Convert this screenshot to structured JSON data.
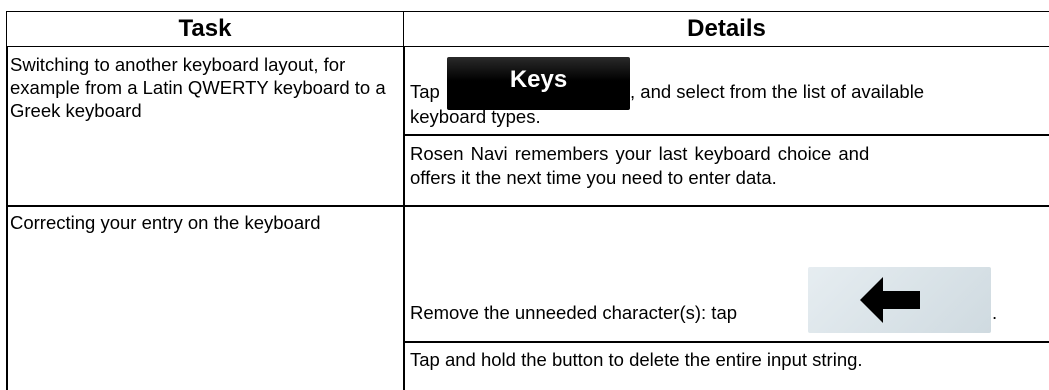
{
  "header": {
    "task": "Task",
    "details": "Details"
  },
  "rows": [
    {
      "task": "Switching to another keyboard layout, for example from a Latin QWERTY keyboard to a Greek keyboard",
      "details": [
        {
          "before_button": "Tap",
          "button_label": "Keys",
          "after_button": ", and select from the list of available",
          "line2": "keyboard types."
        },
        {
          "line1": "Rosen Navi remembers your last keyboard choice and",
          "line2": "offers it the next time you need to enter data."
        }
      ]
    },
    {
      "task": "Correcting your entry on the keyboard",
      "details": [
        {
          "before_button": "Remove the unneeded character(s): tap",
          "button_icon": "left-arrow-icon",
          "after_button": "."
        },
        {
          "line1": "Tap and hold the button to delete the entire input string."
        }
      ]
    }
  ]
}
